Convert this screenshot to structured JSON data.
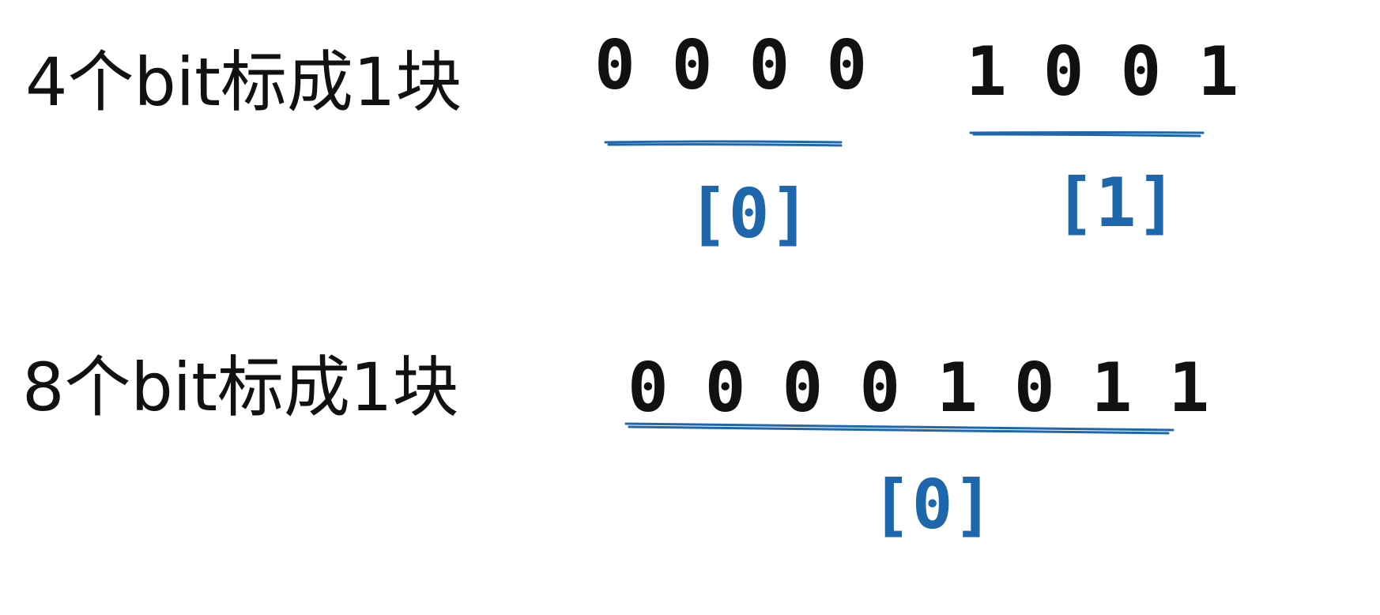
{
  "accent_color": "#1f67ad",
  "text_color": "#111111",
  "rows": [
    {
      "label": "4个bit标成1块",
      "groups": [
        {
          "bits": "0000",
          "index": "[0]"
        },
        {
          "bits": "1001",
          "index": "[1]"
        }
      ]
    },
    {
      "label": "8个bit标成1块",
      "groups": [
        {
          "bits": "00001011",
          "index": "[0]"
        }
      ]
    }
  ]
}
